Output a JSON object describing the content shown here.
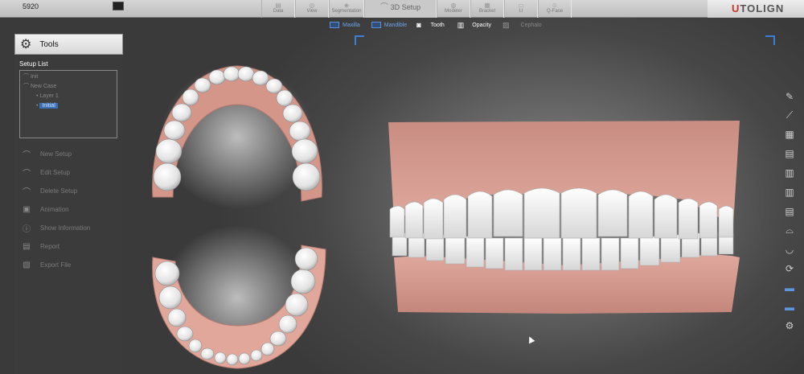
{
  "topbar": {
    "case_id": "5920",
    "nav": [
      {
        "label": "Data",
        "icon": "data-icon"
      },
      {
        "label": "View",
        "icon": "view-icon"
      },
      {
        "label": "Segmentation",
        "icon": "segmentation-icon"
      },
      {
        "label": "3D Setup",
        "icon": "3d-setup-icon"
      },
      {
        "label": "Modeler",
        "icon": "modeler-icon"
      },
      {
        "label": "Bracket",
        "icon": "bracket-icon"
      },
      {
        "label": "I.I",
        "icon": "ii-icon"
      },
      {
        "label": "Q-Face",
        "icon": "q-face-icon"
      }
    ],
    "logo": {
      "first": "U",
      "rest": "TOLIGN"
    }
  },
  "viewbar": {
    "maxilla": "Maxilla",
    "mandible": "Mandible",
    "tooth": "Tooth",
    "opacity": "Opacity",
    "cephalo": "Cephalo"
  },
  "leftpanel": {
    "tools_label": "Tools",
    "setup_list_title": "Setup List",
    "tree": {
      "root": "Init",
      "case": "New Case",
      "layer": "Layer 1",
      "selected": "Initial"
    },
    "menu": [
      {
        "label": "New Setup",
        "icon": "new-setup-icon"
      },
      {
        "label": "Edit Setup",
        "icon": "edit-setup-icon"
      },
      {
        "label": "Delete Setup",
        "icon": "delete-setup-icon"
      },
      {
        "label": "Animation",
        "icon": "animation-icon"
      },
      {
        "label": "Show Information",
        "icon": "info-icon"
      },
      {
        "label": "Report",
        "icon": "report-icon"
      },
      {
        "label": "Export File",
        "icon": "export-file-icon"
      }
    ]
  },
  "colors": {
    "accent": "#3d7fd6",
    "gum": "#d99a8e",
    "tooth": "#f2f2f2",
    "logo_red": "#c8352f"
  }
}
